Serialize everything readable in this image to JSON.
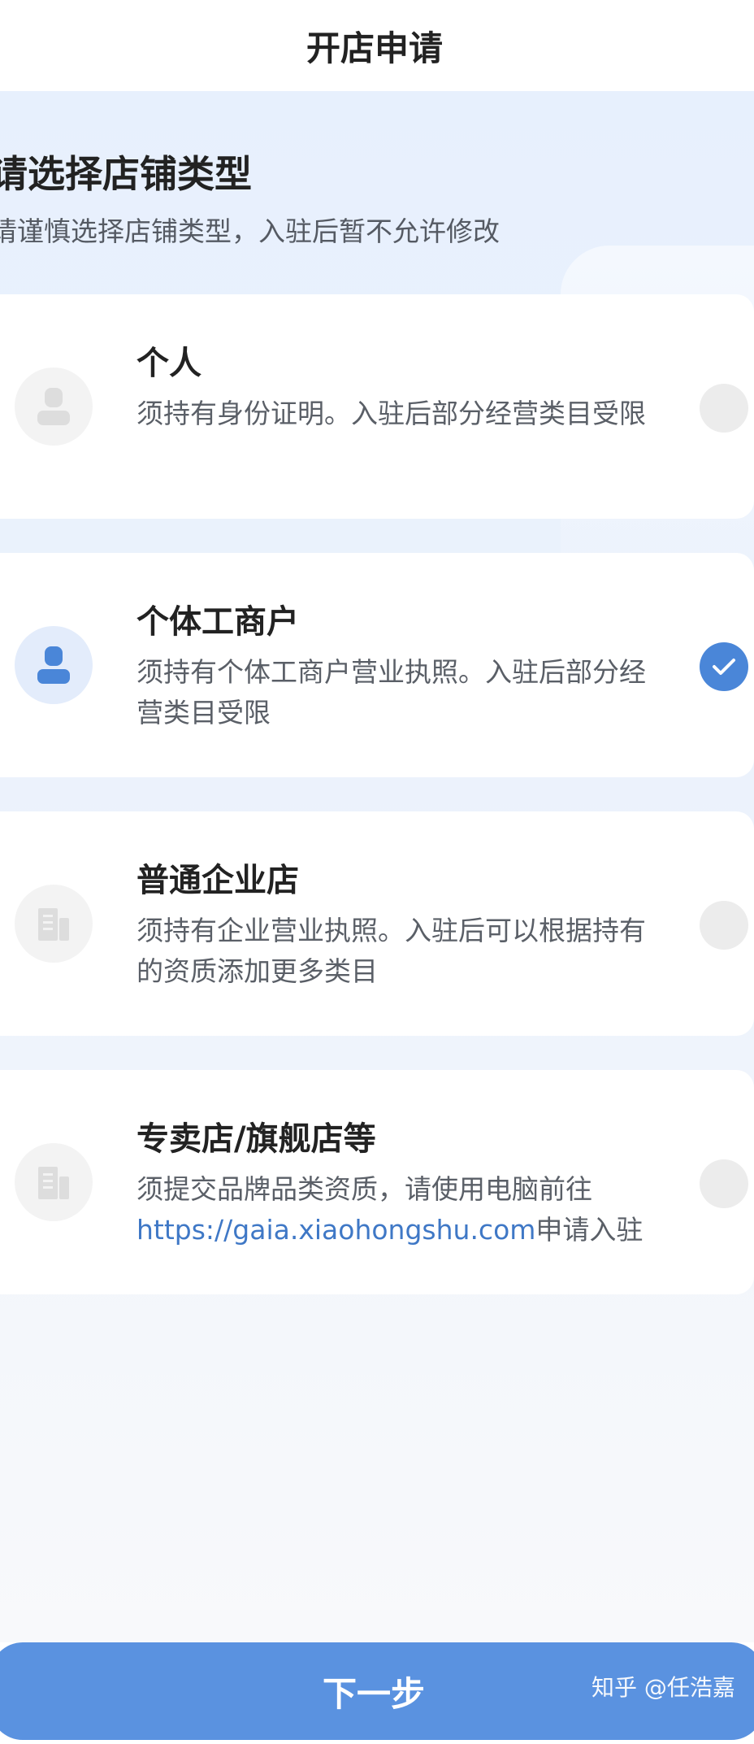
{
  "header": {
    "title": "开店申请"
  },
  "intro": {
    "heading": "请选择店铺类型",
    "subheading": "请谨慎选择店铺类型，入驻后暂不允许修改"
  },
  "options": [
    {
      "title": "个人",
      "description": "须持有身份证明。入驻后部分经营类目受限",
      "icon": "person-icon",
      "selected": false
    },
    {
      "title": "个体工商户",
      "description": "须持有个体工商户营业执照。入驻后部分经营类目受限",
      "icon": "person-icon",
      "selected": true
    },
    {
      "title": "普通企业店",
      "description": "须持有企业营业执照。入驻后可以根据持有的资质添加更多类目",
      "icon": "building-icon",
      "selected": false
    },
    {
      "title": "专卖店/旗舰店等",
      "description_prefix": "须提交品牌品类资质，请使用电脑前往",
      "link": "https://gaia.xiaohongshu.com",
      "description_suffix": "申请入驻",
      "icon": "building-icon",
      "selected": false
    }
  ],
  "footer": {
    "next_label": "下一步",
    "watermark": "知乎 @任浩嘉"
  },
  "colors": {
    "accent": "#4a86d8",
    "button": "#5a92e0",
    "link": "#3f78c6",
    "background": "#e7f0fd"
  }
}
